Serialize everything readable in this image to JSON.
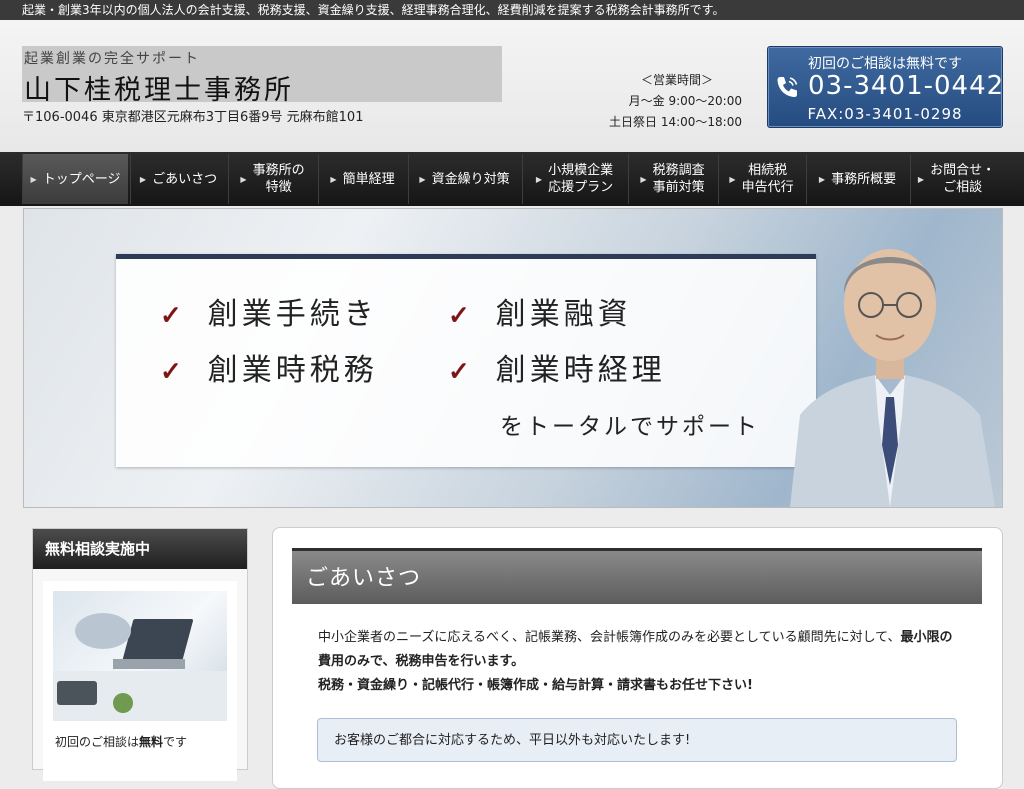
{
  "topbar": {
    "text": "起業・創業3年以内の個人法人の会計支援、税務支援、資金繰り支援、経理事務合理化、経費削減を提案する税務会計事務所です。"
  },
  "header": {
    "tagline": "起業創業の完全サポート",
    "name": "山下桂税理士事務所",
    "address": "〒106-0046 東京都港区元麻布3丁目6番9号 元麻布館101",
    "hours_title": "＜営業時間＞",
    "hours_weekday": "月～金 9:00～20:00",
    "hours_weekend": "土日祭日 14:00～18:00",
    "phone_lead": "初回のご相談は無料です",
    "phone": "03-3401-0442",
    "fax": "FAX:03-3401-0298"
  },
  "nav": {
    "items": [
      {
        "label": "トップページ"
      },
      {
        "label": "ごあいさつ"
      },
      {
        "label": "事務所の特徴",
        "l1": "事務所の",
        "l2": "特徴"
      },
      {
        "label": "簡単経理"
      },
      {
        "label": "資金繰り対策"
      },
      {
        "label": "小規模企業応援プラン",
        "l1": "小規模企業",
        "l2": "応援プラン"
      },
      {
        "label": "税務調査事前対策",
        "l1": "税務調査",
        "l2": "事前対策"
      },
      {
        "label": "相続税申告代行",
        "l1": "相続税",
        "l2": "申告代行"
      },
      {
        "label": "事務所概要"
      },
      {
        "label": "お問合せ・ご相談",
        "l1": "お問合せ・",
        "l2": "ご相談"
      }
    ]
  },
  "hero": {
    "items": [
      "創業手続き",
      "創業融資",
      "創業時税務",
      "創業時経理"
    ],
    "sub": "をトータルでサポート"
  },
  "sidebar": {
    "heading": "無料相談実施中",
    "text_pre": "初回のご相談は",
    "text_bold": "無料",
    "text_post": "です"
  },
  "main": {
    "title": "ごあいさつ",
    "p1a": "中小企業者のニーズに応えるべく、記帳業務、会計帳簿作成のみを必要としている顧問先に対して、",
    "p1b": "最小限の費用のみで、税務申告を行います。",
    "p2": "税務・資金繰り・記帳代行・帳簿作成・給与計算・請求書もお任せ下さい!",
    "notice": "お客様のご都合に対応するため、平日以外も対応いたします!"
  },
  "colors": {
    "accent_blue": "#2f5a8f",
    "check_red": "#7d1616",
    "nav_dark": "#1f1f1f"
  }
}
